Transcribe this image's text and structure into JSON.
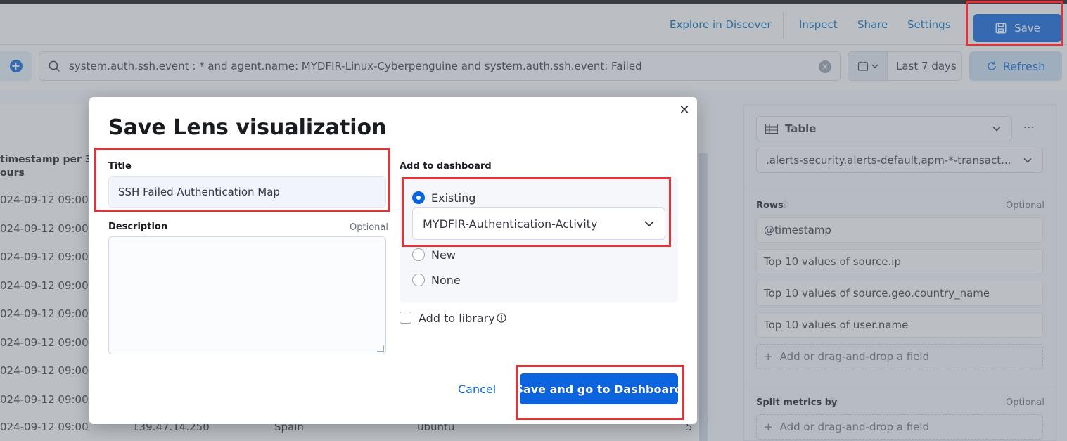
{
  "topnav": {
    "explore_label": "Explore in Discover",
    "inspect_label": "Inspect",
    "share_label": "Share",
    "settings_label": "Settings",
    "save_label": "Save"
  },
  "querybar": {
    "query": "system.auth.ssh.event : * and agent.name: MYDFIR-Linux-Cyberpenguine and system.auth.ssh.event: Failed",
    "date_range": "Last 7 days",
    "refresh_label": "Refresh"
  },
  "table": {
    "column_header_line1": "timestamp per 3",
    "column_header_line2": "ours",
    "timestamps": [
      "024-09-12 09:00",
      "024-09-12 09:00",
      "024-09-12 09:00",
      "024-09-12 09:00",
      "024-09-12 09:00",
      "024-09-12 09:00",
      "024-09-12 09:00",
      "024-09-12 09:00"
    ],
    "last_row": {
      "timestamp": "024-09-12 09:00",
      "ip": "139.47.14.250",
      "country": "Spain",
      "user": "ubuntu",
      "count": "5"
    }
  },
  "config_panel": {
    "chart_type": "Table",
    "data_view": ".alerts-security.alerts-default,apm-*-transact...",
    "rows_label": "Rows",
    "optional": "Optional",
    "rows": [
      "@timestamp",
      "Top 10 values of source.ip",
      "Top 10 values of source.geo.country_name",
      "Top 10 values of user.name"
    ],
    "add_field": "Add or drag-and-drop a field",
    "split_metrics_label": "Split metrics by"
  },
  "modal": {
    "title": "Save Lens visualization",
    "title_field_label": "Title",
    "title_value": "SSH Failed Authentication Map",
    "description_label": "Description",
    "description_optional": "Optional",
    "add_to_dashboard_label": "Add to dashboard",
    "radio_existing": "Existing",
    "selected_dashboard": "MYDFIR-Authentication-Activity",
    "radio_new": "New",
    "radio_none": "None",
    "add_to_library": "Add to library",
    "cancel_label": "Cancel",
    "confirm_label": "Save and go to Dashboard"
  },
  "colors": {
    "primary": "#0b64dd",
    "highlight": "#e0343b"
  }
}
